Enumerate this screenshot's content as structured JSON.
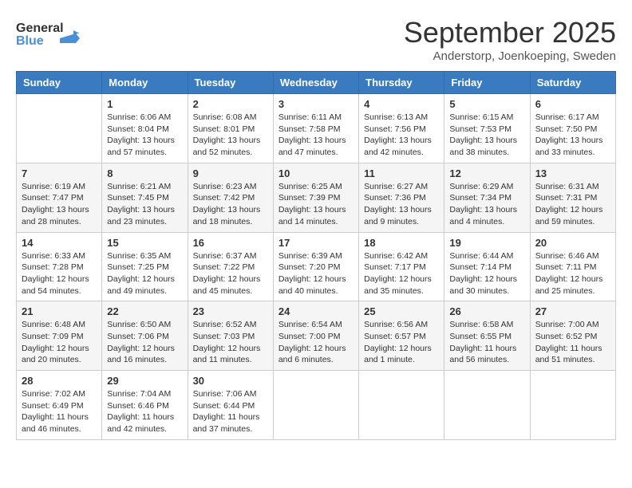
{
  "logo": {
    "text_general": "General",
    "text_blue": "Blue"
  },
  "title": "September 2025",
  "subtitle": "Anderstorp, Joenkoeping, Sweden",
  "days_of_week": [
    "Sunday",
    "Monday",
    "Tuesday",
    "Wednesday",
    "Thursday",
    "Friday",
    "Saturday"
  ],
  "weeks": [
    [
      {
        "day": "",
        "info": ""
      },
      {
        "day": "1",
        "info": "Sunrise: 6:06 AM\nSunset: 8:04 PM\nDaylight: 13 hours\nand 57 minutes."
      },
      {
        "day": "2",
        "info": "Sunrise: 6:08 AM\nSunset: 8:01 PM\nDaylight: 13 hours\nand 52 minutes."
      },
      {
        "day": "3",
        "info": "Sunrise: 6:11 AM\nSunset: 7:58 PM\nDaylight: 13 hours\nand 47 minutes."
      },
      {
        "day": "4",
        "info": "Sunrise: 6:13 AM\nSunset: 7:56 PM\nDaylight: 13 hours\nand 42 minutes."
      },
      {
        "day": "5",
        "info": "Sunrise: 6:15 AM\nSunset: 7:53 PM\nDaylight: 13 hours\nand 38 minutes."
      },
      {
        "day": "6",
        "info": "Sunrise: 6:17 AM\nSunset: 7:50 PM\nDaylight: 13 hours\nand 33 minutes."
      }
    ],
    [
      {
        "day": "7",
        "info": "Sunrise: 6:19 AM\nSunset: 7:47 PM\nDaylight: 13 hours\nand 28 minutes."
      },
      {
        "day": "8",
        "info": "Sunrise: 6:21 AM\nSunset: 7:45 PM\nDaylight: 13 hours\nand 23 minutes."
      },
      {
        "day": "9",
        "info": "Sunrise: 6:23 AM\nSunset: 7:42 PM\nDaylight: 13 hours\nand 18 minutes."
      },
      {
        "day": "10",
        "info": "Sunrise: 6:25 AM\nSunset: 7:39 PM\nDaylight: 13 hours\nand 14 minutes."
      },
      {
        "day": "11",
        "info": "Sunrise: 6:27 AM\nSunset: 7:36 PM\nDaylight: 13 hours\nand 9 minutes."
      },
      {
        "day": "12",
        "info": "Sunrise: 6:29 AM\nSunset: 7:34 PM\nDaylight: 13 hours\nand 4 minutes."
      },
      {
        "day": "13",
        "info": "Sunrise: 6:31 AM\nSunset: 7:31 PM\nDaylight: 12 hours\nand 59 minutes."
      }
    ],
    [
      {
        "day": "14",
        "info": "Sunrise: 6:33 AM\nSunset: 7:28 PM\nDaylight: 12 hours\nand 54 minutes."
      },
      {
        "day": "15",
        "info": "Sunrise: 6:35 AM\nSunset: 7:25 PM\nDaylight: 12 hours\nand 49 minutes."
      },
      {
        "day": "16",
        "info": "Sunrise: 6:37 AM\nSunset: 7:22 PM\nDaylight: 12 hours\nand 45 minutes."
      },
      {
        "day": "17",
        "info": "Sunrise: 6:39 AM\nSunset: 7:20 PM\nDaylight: 12 hours\nand 40 minutes."
      },
      {
        "day": "18",
        "info": "Sunrise: 6:42 AM\nSunset: 7:17 PM\nDaylight: 12 hours\nand 35 minutes."
      },
      {
        "day": "19",
        "info": "Sunrise: 6:44 AM\nSunset: 7:14 PM\nDaylight: 12 hours\nand 30 minutes."
      },
      {
        "day": "20",
        "info": "Sunrise: 6:46 AM\nSunset: 7:11 PM\nDaylight: 12 hours\nand 25 minutes."
      }
    ],
    [
      {
        "day": "21",
        "info": "Sunrise: 6:48 AM\nSunset: 7:09 PM\nDaylight: 12 hours\nand 20 minutes."
      },
      {
        "day": "22",
        "info": "Sunrise: 6:50 AM\nSunset: 7:06 PM\nDaylight: 12 hours\nand 16 minutes."
      },
      {
        "day": "23",
        "info": "Sunrise: 6:52 AM\nSunset: 7:03 PM\nDaylight: 12 hours\nand 11 minutes."
      },
      {
        "day": "24",
        "info": "Sunrise: 6:54 AM\nSunset: 7:00 PM\nDaylight: 12 hours\nand 6 minutes."
      },
      {
        "day": "25",
        "info": "Sunrise: 6:56 AM\nSunset: 6:57 PM\nDaylight: 12 hours\nand 1 minute."
      },
      {
        "day": "26",
        "info": "Sunrise: 6:58 AM\nSunset: 6:55 PM\nDaylight: 11 hours\nand 56 minutes."
      },
      {
        "day": "27",
        "info": "Sunrise: 7:00 AM\nSunset: 6:52 PM\nDaylight: 11 hours\nand 51 minutes."
      }
    ],
    [
      {
        "day": "28",
        "info": "Sunrise: 7:02 AM\nSunset: 6:49 PM\nDaylight: 11 hours\nand 46 minutes."
      },
      {
        "day": "29",
        "info": "Sunrise: 7:04 AM\nSunset: 6:46 PM\nDaylight: 11 hours\nand 42 minutes."
      },
      {
        "day": "30",
        "info": "Sunrise: 7:06 AM\nSunset: 6:44 PM\nDaylight: 11 hours\nand 37 minutes."
      },
      {
        "day": "",
        "info": ""
      },
      {
        "day": "",
        "info": ""
      },
      {
        "day": "",
        "info": ""
      },
      {
        "day": "",
        "info": ""
      }
    ]
  ]
}
